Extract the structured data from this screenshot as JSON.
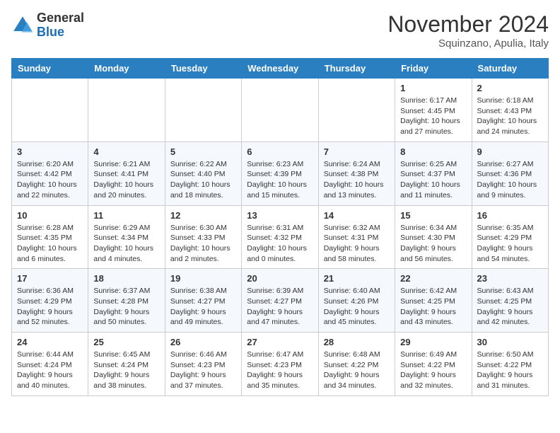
{
  "header": {
    "logo_line1": "General",
    "logo_line2": "Blue",
    "month": "November 2024",
    "location": "Squinzano, Apulia, Italy"
  },
  "weekdays": [
    "Sunday",
    "Monday",
    "Tuesday",
    "Wednesday",
    "Thursday",
    "Friday",
    "Saturday"
  ],
  "weeks": [
    [
      {
        "day": "",
        "info": ""
      },
      {
        "day": "",
        "info": ""
      },
      {
        "day": "",
        "info": ""
      },
      {
        "day": "",
        "info": ""
      },
      {
        "day": "",
        "info": ""
      },
      {
        "day": "1",
        "info": "Sunrise: 6:17 AM\nSunset: 4:45 PM\nDaylight: 10 hours\nand 27 minutes."
      },
      {
        "day": "2",
        "info": "Sunrise: 6:18 AM\nSunset: 4:43 PM\nDaylight: 10 hours\nand 24 minutes."
      }
    ],
    [
      {
        "day": "3",
        "info": "Sunrise: 6:20 AM\nSunset: 4:42 PM\nDaylight: 10 hours\nand 22 minutes."
      },
      {
        "day": "4",
        "info": "Sunrise: 6:21 AM\nSunset: 4:41 PM\nDaylight: 10 hours\nand 20 minutes."
      },
      {
        "day": "5",
        "info": "Sunrise: 6:22 AM\nSunset: 4:40 PM\nDaylight: 10 hours\nand 18 minutes."
      },
      {
        "day": "6",
        "info": "Sunrise: 6:23 AM\nSunset: 4:39 PM\nDaylight: 10 hours\nand 15 minutes."
      },
      {
        "day": "7",
        "info": "Sunrise: 6:24 AM\nSunset: 4:38 PM\nDaylight: 10 hours\nand 13 minutes."
      },
      {
        "day": "8",
        "info": "Sunrise: 6:25 AM\nSunset: 4:37 PM\nDaylight: 10 hours\nand 11 minutes."
      },
      {
        "day": "9",
        "info": "Sunrise: 6:27 AM\nSunset: 4:36 PM\nDaylight: 10 hours\nand 9 minutes."
      }
    ],
    [
      {
        "day": "10",
        "info": "Sunrise: 6:28 AM\nSunset: 4:35 PM\nDaylight: 10 hours\nand 6 minutes."
      },
      {
        "day": "11",
        "info": "Sunrise: 6:29 AM\nSunset: 4:34 PM\nDaylight: 10 hours\nand 4 minutes."
      },
      {
        "day": "12",
        "info": "Sunrise: 6:30 AM\nSunset: 4:33 PM\nDaylight: 10 hours\nand 2 minutes."
      },
      {
        "day": "13",
        "info": "Sunrise: 6:31 AM\nSunset: 4:32 PM\nDaylight: 10 hours\nand 0 minutes."
      },
      {
        "day": "14",
        "info": "Sunrise: 6:32 AM\nSunset: 4:31 PM\nDaylight: 9 hours\nand 58 minutes."
      },
      {
        "day": "15",
        "info": "Sunrise: 6:34 AM\nSunset: 4:30 PM\nDaylight: 9 hours\nand 56 minutes."
      },
      {
        "day": "16",
        "info": "Sunrise: 6:35 AM\nSunset: 4:29 PM\nDaylight: 9 hours\nand 54 minutes."
      }
    ],
    [
      {
        "day": "17",
        "info": "Sunrise: 6:36 AM\nSunset: 4:29 PM\nDaylight: 9 hours\nand 52 minutes."
      },
      {
        "day": "18",
        "info": "Sunrise: 6:37 AM\nSunset: 4:28 PM\nDaylight: 9 hours\nand 50 minutes."
      },
      {
        "day": "19",
        "info": "Sunrise: 6:38 AM\nSunset: 4:27 PM\nDaylight: 9 hours\nand 49 minutes."
      },
      {
        "day": "20",
        "info": "Sunrise: 6:39 AM\nSunset: 4:27 PM\nDaylight: 9 hours\nand 47 minutes."
      },
      {
        "day": "21",
        "info": "Sunrise: 6:40 AM\nSunset: 4:26 PM\nDaylight: 9 hours\nand 45 minutes."
      },
      {
        "day": "22",
        "info": "Sunrise: 6:42 AM\nSunset: 4:25 PM\nDaylight: 9 hours\nand 43 minutes."
      },
      {
        "day": "23",
        "info": "Sunrise: 6:43 AM\nSunset: 4:25 PM\nDaylight: 9 hours\nand 42 minutes."
      }
    ],
    [
      {
        "day": "24",
        "info": "Sunrise: 6:44 AM\nSunset: 4:24 PM\nDaylight: 9 hours\nand 40 minutes."
      },
      {
        "day": "25",
        "info": "Sunrise: 6:45 AM\nSunset: 4:24 PM\nDaylight: 9 hours\nand 38 minutes."
      },
      {
        "day": "26",
        "info": "Sunrise: 6:46 AM\nSunset: 4:23 PM\nDaylight: 9 hours\nand 37 minutes."
      },
      {
        "day": "27",
        "info": "Sunrise: 6:47 AM\nSunset: 4:23 PM\nDaylight: 9 hours\nand 35 minutes."
      },
      {
        "day": "28",
        "info": "Sunrise: 6:48 AM\nSunset: 4:22 PM\nDaylight: 9 hours\nand 34 minutes."
      },
      {
        "day": "29",
        "info": "Sunrise: 6:49 AM\nSunset: 4:22 PM\nDaylight: 9 hours\nand 32 minutes."
      },
      {
        "day": "30",
        "info": "Sunrise: 6:50 AM\nSunset: 4:22 PM\nDaylight: 9 hours\nand 31 minutes."
      }
    ]
  ]
}
